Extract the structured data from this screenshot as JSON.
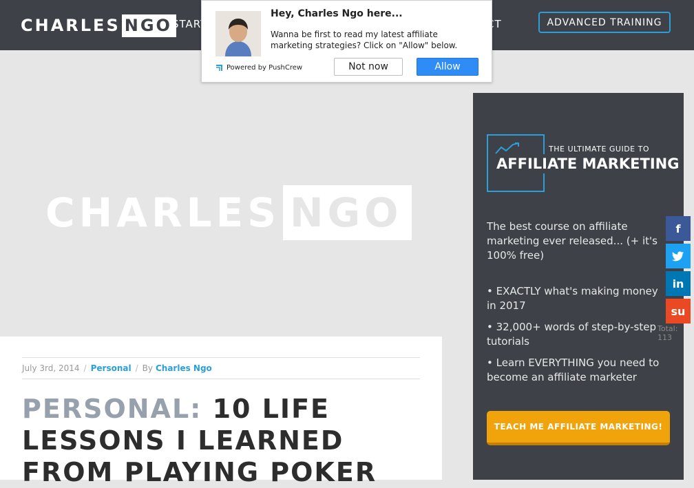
{
  "header": {
    "logo_part1": "CHARLES",
    "logo_part2": "NGO",
    "nav_left": "START",
    "nav_right": "ACT",
    "advanced_button": "ADVANCED TRAINING"
  },
  "hero": {
    "logo_part1": "CHARLES",
    "logo_part2": "NGO"
  },
  "article": {
    "date": "July 3rd, 2014",
    "separator": "/",
    "category": "Personal",
    "by_label": "By",
    "author": "Charles Ngo",
    "title_category": "PERSONAL:",
    "title_text": "10 LIFE LESSONS I LEARNED FROM PLAYING POKER"
  },
  "sidebar": {
    "guide_small": "THE ULTIMATE GUIDE TO",
    "guide_big": "AFFILIATE MARKETING",
    "description": "The best course on affiliate marketing ever released... (+ it's 100% free)",
    "bullets": [
      "• EXACTLY what's making money in 2017",
      "• 32,000+ words of step-by-step tutorials",
      "• Learn EVERYTHING you need to become an affiliate marketer"
    ],
    "cta": "TEACH ME AFFILIATE MARKETING!"
  },
  "share": {
    "buttons": [
      {
        "icon": "facebook-icon",
        "glyph": "f",
        "color": "#3b5998"
      },
      {
        "icon": "twitter-icon",
        "glyph": "t",
        "color": "#1da1f2"
      },
      {
        "icon": "linkedin-icon",
        "glyph": "in",
        "color": "#0077b5"
      },
      {
        "icon": "stumbleupon-icon",
        "glyph": "su",
        "color": "#eb4924"
      }
    ],
    "total": "Total: 113"
  },
  "popup": {
    "title": "Hey, Charles Ngo here...",
    "text": "Wanna be first to read my latest affiliate marketing strategies? Click on \"Allow\" below.",
    "powered_by": "Powered by PushCrew",
    "not_now": "Not now",
    "allow": "Allow"
  },
  "colors": {
    "header_bg": "#3e4147",
    "accent": "#2a9fd8",
    "cta": "#f0a30a",
    "allow_button": "#2f8bf5"
  }
}
